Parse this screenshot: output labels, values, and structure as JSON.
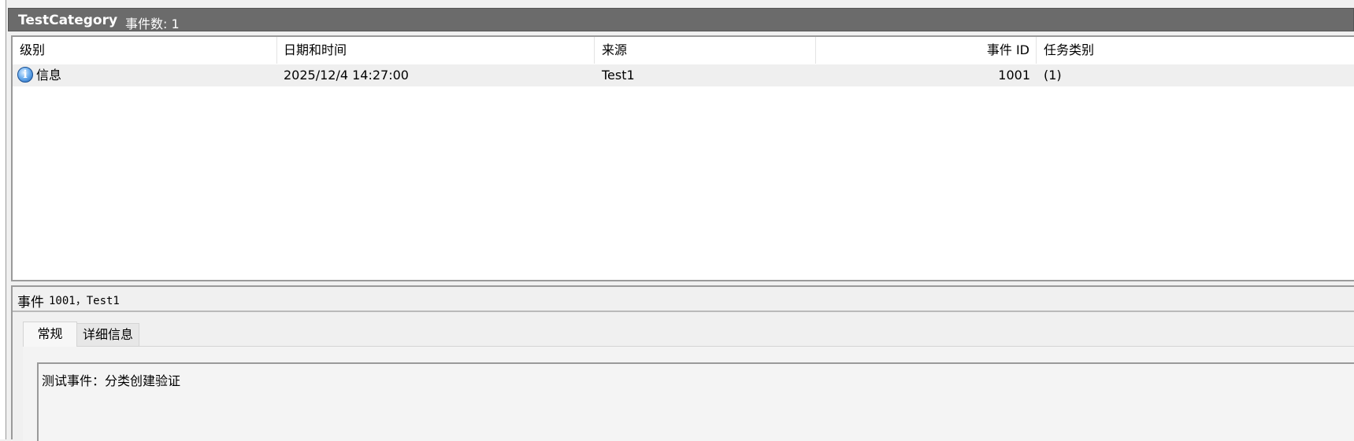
{
  "header": {
    "title": "TestCategory",
    "event_count": "事件数: 1"
  },
  "columns": [
    "级别",
    "日期和时间",
    "来源",
    "事件 ID",
    "任务类别"
  ],
  "rows": [
    {
      "level_icon": "info-icon",
      "level": "信息",
      "datetime": "2025/12/4 14:27:00",
      "source": "Test1",
      "event_id": "1001",
      "task_category": "(1)"
    }
  ],
  "detail": {
    "title_prefix": "事件",
    "title_ids": "1001，Test1",
    "tabs": [
      "常规",
      "详细信息"
    ],
    "active_tab": "常规",
    "description": "测试事件：分类创建验证"
  },
  "colors": {
    "title_bar": "#6b6b6b",
    "row_selected": "#efefef",
    "info_icon": "#1d64b8"
  }
}
